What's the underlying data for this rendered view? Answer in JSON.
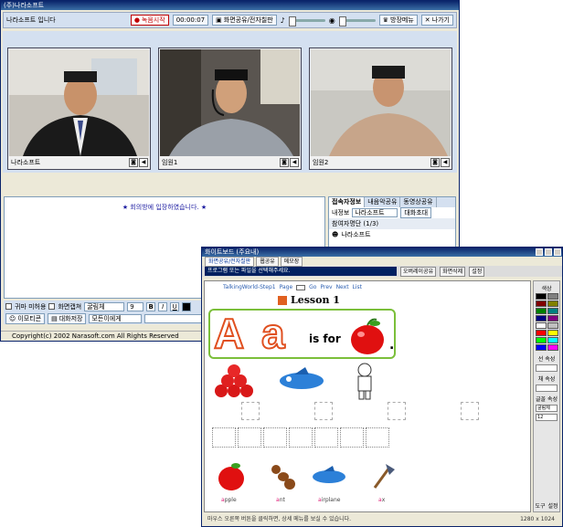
{
  "main": {
    "title": "(주)나라소프트",
    "toolbar": {
      "user_label": "나라소프트 입니다",
      "record_button": "녹음시작",
      "timer": "00:00:07",
      "screen_button": "화면공유/전자칠판",
      "broadcast_button": "방장메뉴",
      "exit_button": "나가기"
    },
    "videos": [
      {
        "name": "나라소프트"
      },
      {
        "name": "임원1"
      },
      {
        "name": "임원2"
      }
    ],
    "chat": {
      "message": "★ 회의방에 입장하였습니다. ★"
    },
    "chat_controls": {
      "mute_label": "귀마 미허용",
      "screen_capture_label": "화면캡쳐",
      "font_select": "굴림체",
      "size_select": "9",
      "bold": "B",
      "italic": "I",
      "underline": "U",
      "emoticon_button": "이모티콘",
      "save_button": "대화저장",
      "recipient_select": "모든이에게"
    },
    "participants": {
      "tabs": [
        "접속자정보",
        "내음악공유",
        "동영상공유"
      ],
      "my_info_label": "내정보",
      "my_info_value": "나라소프트",
      "invite_button": "대화초대",
      "group_label": "참여자명단 (1/3)",
      "member": "나라소프트"
    },
    "status": "Copyright(c) 2002 Narasoft.com All Rights Reserved"
  },
  "whiteboard": {
    "title": "화이트보드 (주요내)",
    "tabs": [
      "화면공유/전자칠판",
      "웹공유",
      "메모장"
    ],
    "select_text": "프로그램 또는 파일을 선택해주세요.",
    "buttons": [
      "오버레이공유",
      "화면삭제",
      "설정"
    ],
    "nav": {
      "link": "TalkingWorld-Step1",
      "page_label": "Page",
      "items": [
        "Go",
        "Prev",
        "Next",
        "List"
      ]
    },
    "lesson": {
      "title": "Lesson 1",
      "big_upper": "A",
      "big_lower": "a",
      "is_for": "is for"
    },
    "words": [
      {
        "first": "a",
        "rest": "pple"
      },
      {
        "first": "a",
        "rest": "nt"
      },
      {
        "first": "a",
        "rest": "irplane"
      },
      {
        "first": "a",
        "rest": "x"
      }
    ],
    "tools": {
      "color_label": "색상",
      "line_label": "선 속성",
      "fill_label": "채 속성",
      "font_label": "글꼴 속성",
      "font_value": "굴림체",
      "size_value": "12",
      "palette": [
        "#000000",
        "#808080",
        "#800000",
        "#808000",
        "#008000",
        "#008080",
        "#000080",
        "#800080",
        "#ffffff",
        "#c0c0c0",
        "#ff0000",
        "#ffff00",
        "#00ff00",
        "#00ffff",
        "#0000ff",
        "#ff00ff"
      ],
      "bottom_labels": [
        "도구",
        "설정"
      ]
    },
    "status_text": "마우스 오른쪽 버튼을 클릭하면, 상세 메뉴를 보실 수 있습니다.",
    "status_size": "1280 x 1024"
  }
}
